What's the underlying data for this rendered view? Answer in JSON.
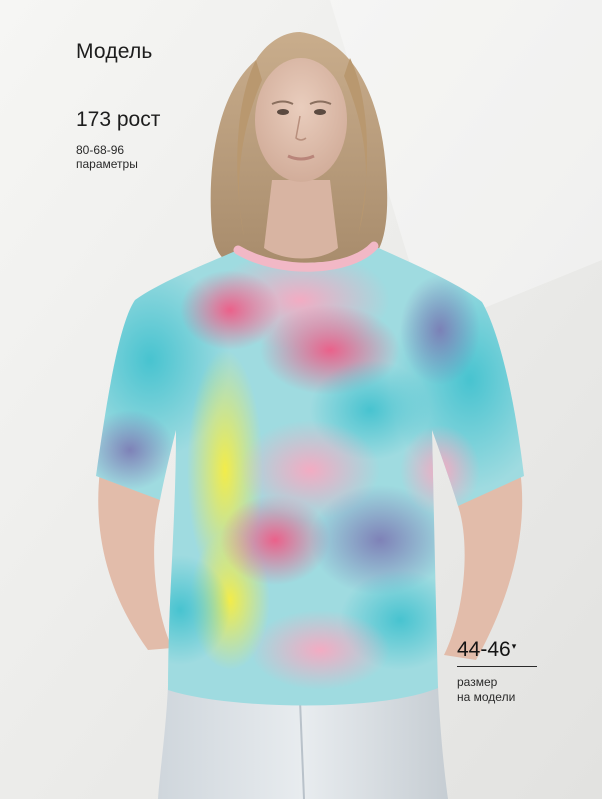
{
  "model": {
    "title": "Модель",
    "height": "173 рост",
    "measurements": "80-68-96",
    "measurements_label": "параметры"
  },
  "size": {
    "value": "44-46",
    "caret": "▾",
    "label_line1": "размер",
    "label_line2": "на модели"
  }
}
